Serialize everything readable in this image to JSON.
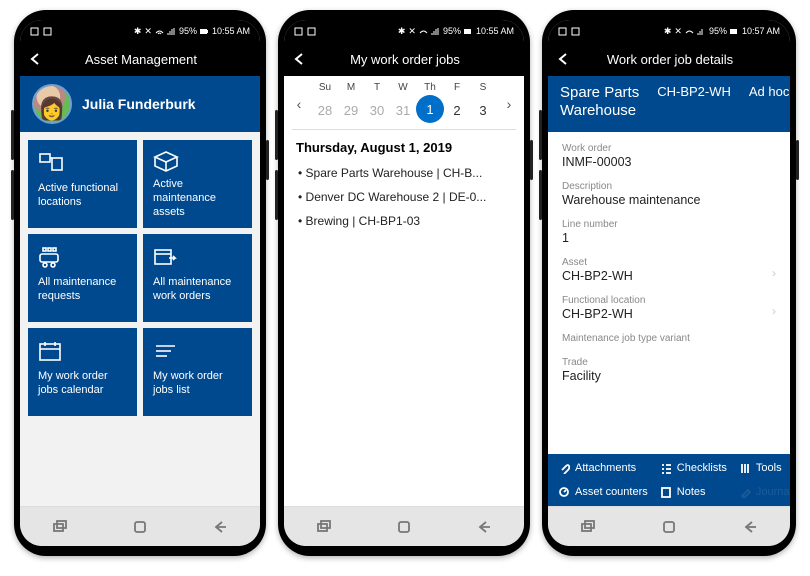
{
  "status": {
    "battery": "95%",
    "time1": "10:55 AM",
    "time2": "10:55 AM",
    "time3": "10:57 AM"
  },
  "phone1": {
    "title": "Asset Management",
    "username": "Julia Funderburk",
    "tiles": [
      "Active functional locations",
      "Active maintenance assets",
      "All maintenance requests",
      "All maintenance work orders",
      "My work order jobs calendar",
      "My work order jobs list"
    ]
  },
  "phone2": {
    "title": "My work order jobs",
    "dow": [
      "Su",
      "M",
      "T",
      "W",
      "Th",
      "F",
      "S"
    ],
    "days": [
      "28",
      "29",
      "30",
      "31",
      "1",
      "2",
      "3"
    ],
    "dateHeading": "Thursday, August 1, 2019",
    "items": [
      "Spare Parts Warehouse | CH-B...",
      "Denver DC Warehouse 2 | DE-0...",
      "Brewing | CH-BP1-03"
    ]
  },
  "phone3": {
    "title": "Work order job details",
    "tabs": {
      "main1": "Spare Parts",
      "main2": "Warehouse",
      "t2": "CH-BP2-WH",
      "t3": "Ad hoc"
    },
    "fields": {
      "workorder_lab": "Work order",
      "workorder_val": "INMF-00003",
      "desc_lab": "Description",
      "desc_val": "Warehouse maintenance",
      "line_lab": "Line number",
      "line_val": "1",
      "asset_lab": "Asset",
      "asset_val": "CH-BP2-WH",
      "funcloc_lab": "Functional location",
      "funcloc_val": "CH-BP2-WH",
      "variant_lab": "Maintenance job type variant",
      "trade_lab": "Trade",
      "trade_val": "Facility"
    },
    "actions": {
      "a1": "Attachments",
      "a2": "Checklists",
      "a3": "Tools",
      "a4": "Asset counters",
      "a5": "Notes",
      "a6": "Journal"
    }
  }
}
